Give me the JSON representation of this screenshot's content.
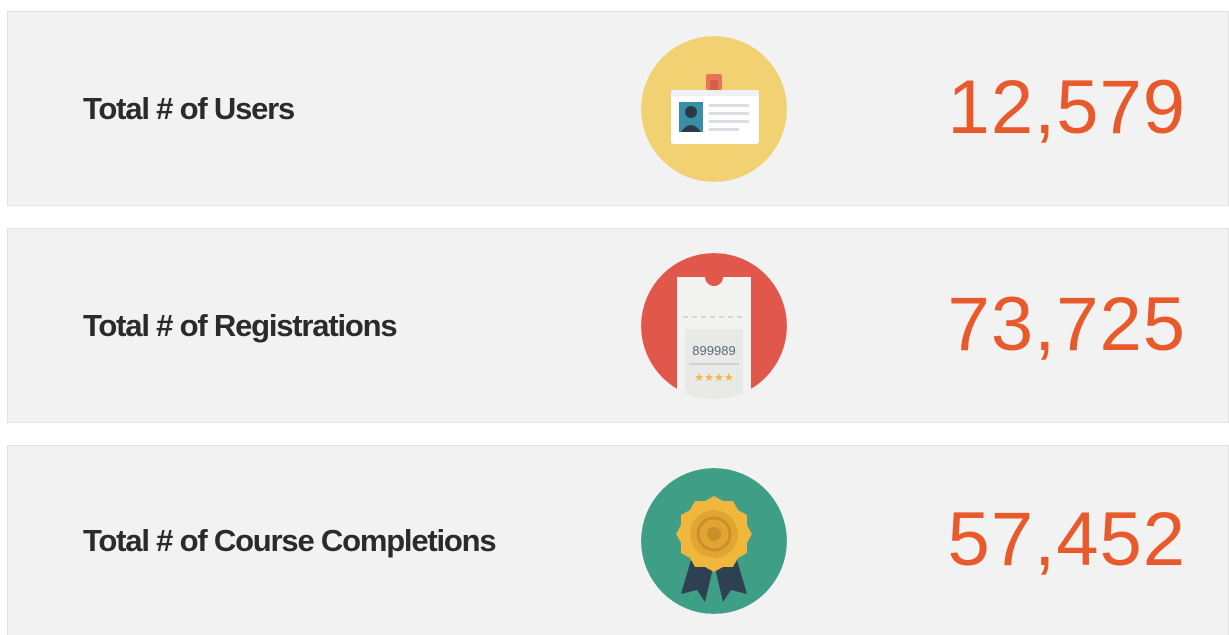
{
  "accent_color": "#e85a2b",
  "stats": [
    {
      "label": "Total # of Users",
      "value": "12,579",
      "icon": "id-badge-icon",
      "icon_bg": "#f2d173"
    },
    {
      "label": "Total # of Registrations",
      "value": "73,725",
      "icon": "ticket-icon",
      "icon_bg": "#e2574c",
      "ticket_number": "899989"
    },
    {
      "label": "Total # of Course Completions",
      "value": "57,452",
      "icon": "award-medal-icon",
      "icon_bg": "#3e9e86"
    }
  ]
}
